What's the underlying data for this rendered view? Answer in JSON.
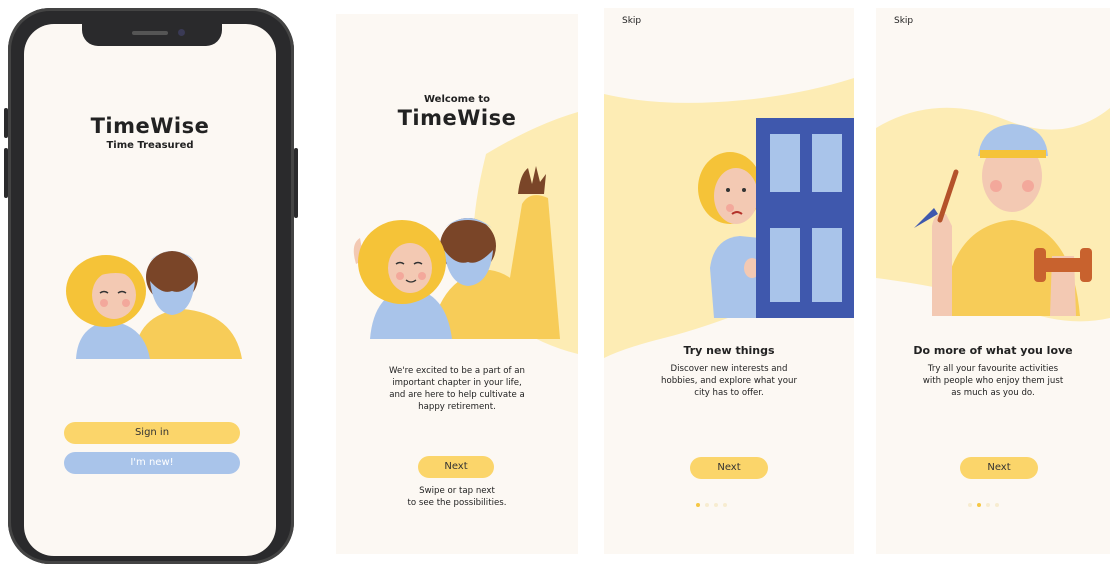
{
  "phone_screen": {
    "title": "TimeWise",
    "subtitle": "Time Treasured",
    "signin_label": "Sign in",
    "new_label": "I'm new!"
  },
  "panels": [
    {
      "welcome_small": "Welcome to",
      "welcome_title": "TimeWise",
      "body": [
        "We're excited to be a part of an",
        "important chapter in your life,",
        "and are here to help cultivate a",
        "happy retirement."
      ],
      "next_label": "Next",
      "hint": [
        "Swipe or tap next",
        "to see the possibilities."
      ]
    },
    {
      "skip_label": "Skip",
      "heading": "Try new things",
      "body": [
        "Discover new interests and",
        "hobbies, and explore what your",
        "city has to offer."
      ],
      "next_label": "Next",
      "dots": 4,
      "active_dot": 0
    },
    {
      "skip_label": "Skip",
      "heading": "Do more of what you love",
      "body": [
        "Try all your favourite activities",
        "with people who enjoy them just",
        "as much as you do."
      ],
      "next_label": "Next",
      "dots": 4,
      "active_dot": 1
    }
  ],
  "colors": {
    "background": "#fcf8f3",
    "accent_yellow": "#fbd56a",
    "accent_blue": "#a9c4ea",
    "door_blue": "#3f58ad",
    "skin": "#f3c9b3",
    "dark_skin": "#7a4528",
    "hair_yellow": "#f5c338"
  }
}
